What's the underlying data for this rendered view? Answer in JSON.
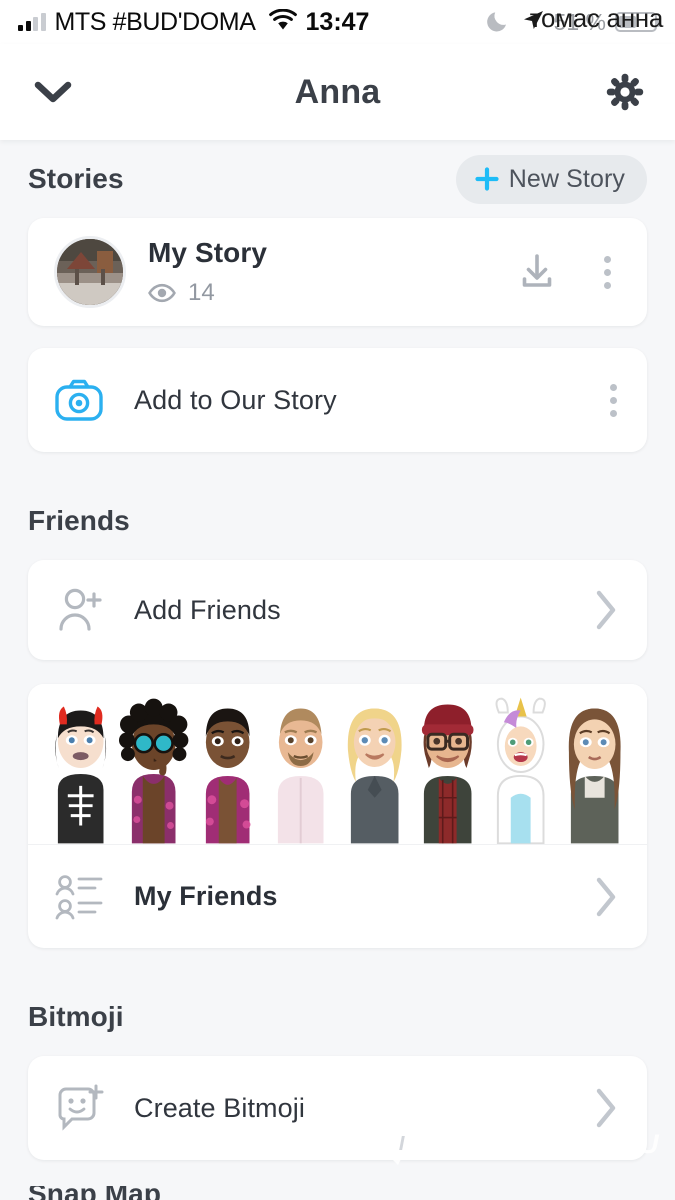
{
  "status_bar": {
    "carrier": "MTS #BUD'DOMA",
    "time": "13:47",
    "battery_percent": "51 %",
    "battery_level": 51,
    "signal_bars_filled": 2,
    "signal_bars_total": 4,
    "wifi_icon": "wifi-icon",
    "moon_icon": "moon-icon",
    "location_icon": "location-arrow-icon",
    "overlay_text": "томас анна"
  },
  "header": {
    "back_icon": "chevron-down-icon",
    "title": "Anna",
    "settings_icon": "gear-icon"
  },
  "stories": {
    "section_title": "Stories",
    "new_story_button": {
      "label": "New Story",
      "icon": "plus-icon",
      "icon_color": "#1dbcf7",
      "bg_color": "#e7eaed"
    },
    "items": [
      {
        "name": "My Story",
        "views_icon": "eye-icon",
        "views": "14",
        "thumbnail": "story-thumbnail",
        "actions": [
          "download-icon",
          "more-options-icon"
        ]
      },
      {
        "name": "Add to Our Story",
        "icon": "camera-icon",
        "icon_color": "#2bb0f0",
        "actions": [
          "more-options-icon"
        ]
      }
    ]
  },
  "friends": {
    "section_title": "Friends",
    "add_friends": {
      "label": "Add Friends",
      "icon": "add-person-icon",
      "chevron": "chevron-right-icon"
    },
    "bitmoji_strip": {
      "count": 8,
      "avatars": [
        {
          "name": "devil-skeleton-girl",
          "skin": "#f6dfce",
          "hair": "#221f1f",
          "shirt": "#2b2b2b",
          "accent": "#e02b20"
        },
        {
          "name": "dreadlocks-sunglasses-man",
          "skin": "#6b4429",
          "hair": "#16120f",
          "shirt": "#8b2f6b",
          "accent": "#2fb8c8"
        },
        {
          "name": "floral-shirt-man",
          "skin": "#7a5235",
          "hair": "#1b1512",
          "shirt": "#a02d75",
          "accent": "#d94f9a"
        },
        {
          "name": "pink-shirt-bearded-man",
          "skin": "#e8b893",
          "hair": "#b08a5e",
          "shirt": "#f3e2e8",
          "accent": "#c2a07a"
        },
        {
          "name": "blonde-woman-grey-top",
          "skin": "#f4d2b4",
          "hair": "#f0d48a",
          "shirt": "#555d63",
          "accent": "#e3c377"
        },
        {
          "name": "beanie-glasses-person",
          "skin": "#e7b68f",
          "hair": "#6b3b2a",
          "shirt": "#8d2a2a",
          "accent": "#8e1f2b"
        },
        {
          "name": "unicorn-onesie-girl",
          "skin": "#f7d9bd",
          "hair": "#f2f2f2",
          "shirt": "#a7e0ef",
          "accent": "#c58ad8"
        },
        {
          "name": "brunette-woman-scarf",
          "skin": "#f3d2b2",
          "hair": "#7a5438",
          "shirt": "#5d6259",
          "accent": "#e8e4dc"
        }
      ]
    },
    "my_friends": {
      "label": "My Friends",
      "icon": "friends-list-icon",
      "chevron": "chevron-right-icon"
    }
  },
  "bitmoji": {
    "section_title": "Bitmoji",
    "create": {
      "label": "Create Bitmoji",
      "icon": "bitmoji-add-icon",
      "chevron": "chevron-right-icon"
    }
  },
  "watermark": {
    "badge_letter": "I",
    "text": "RECOMMEND.RU"
  }
}
